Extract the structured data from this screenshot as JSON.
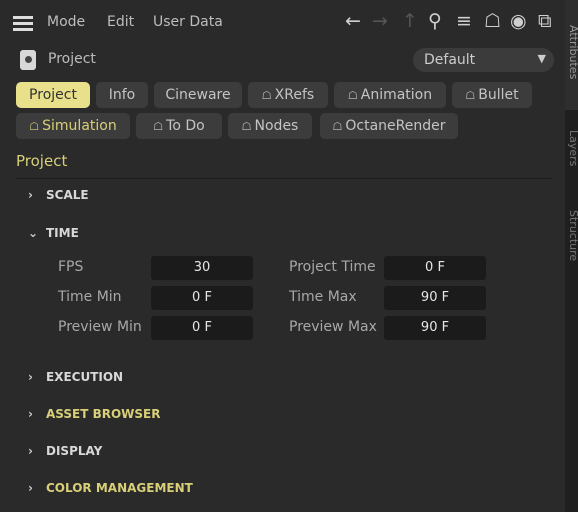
{
  "menu": {
    "mode": "Mode",
    "edit": "Edit",
    "user_data": "User Data"
  },
  "header": {
    "title": "Project",
    "preset": "Default"
  },
  "tabs": [
    {
      "label": "Project",
      "active": true
    },
    {
      "label": "Info"
    },
    {
      "label": "Cineware"
    },
    {
      "label": "XRefs",
      "locked": true
    },
    {
      "label": "Animation",
      "locked": true
    },
    {
      "label": "Bullet",
      "locked": true
    },
    {
      "label": "Simulation",
      "locked": true
    },
    {
      "label": "To Do",
      "locked": true
    },
    {
      "label": "Nodes",
      "locked": true
    },
    {
      "label": "OctaneRender",
      "locked": true
    }
  ],
  "lock_glyph": "☖",
  "section_title": "Project",
  "sections": {
    "scale": "SCALE",
    "time": "TIME",
    "execution": "EXECUTION",
    "asset_browser": "ASSET BROWSER",
    "display": "DISPLAY",
    "color_management": "COLOR MANAGEMENT"
  },
  "time": {
    "fps_label": "FPS",
    "fps": "30",
    "project_time_label": "Project Time",
    "project_time": "0 F",
    "time_min_label": "Time Min",
    "time_min": "0 F",
    "time_max_label": "Time Max",
    "time_max": "90 F",
    "preview_min_label": "Preview Min",
    "preview_min": "0 F",
    "preview_max_label": "Preview Max",
    "preview_max": "90 F"
  },
  "side_tabs": {
    "attributes": "Attributes",
    "layers": "Layers",
    "structure": "Structure"
  },
  "colors": {
    "accent": "#e8e08a",
    "accent_text": "#d8cf78",
    "background": "#2a2a2a",
    "field": "#1b1b1b"
  }
}
